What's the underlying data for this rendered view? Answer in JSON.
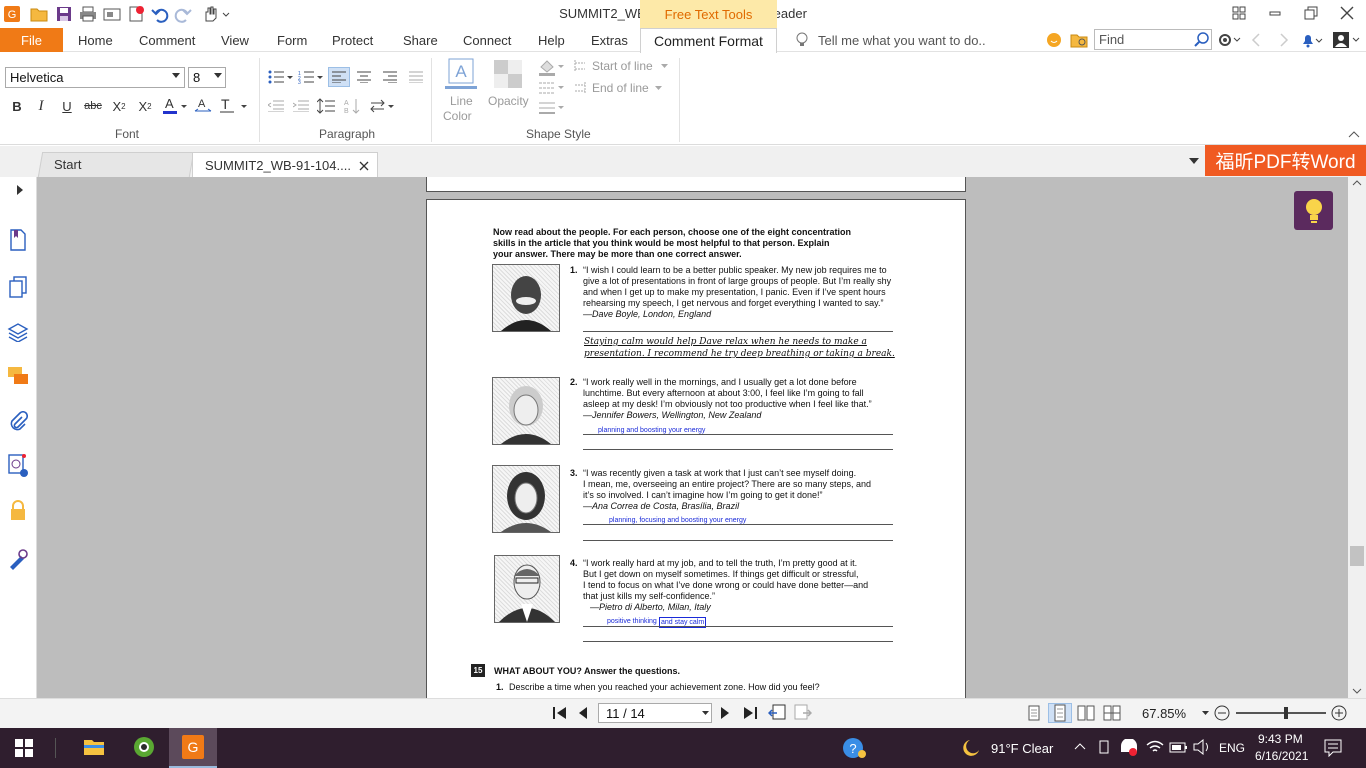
{
  "app": {
    "title": "SUMMIT2_WB-91-104.pdf * - Foxit Reader",
    "context_tab": "Free Text Tools",
    "window_icons": [
      "layout-icon",
      "minimize-icon",
      "restore-icon",
      "close-icon"
    ]
  },
  "menu": {
    "file": "File",
    "items": [
      "Home",
      "Comment",
      "View",
      "Form",
      "Protect",
      "Share",
      "Connect",
      "Help",
      "Extras"
    ],
    "active": "Comment Format",
    "tellme": "Tell me what you want to do..",
    "find_placeholder": "Find"
  },
  "ribbon": {
    "font": {
      "name": "Helvetica",
      "size": "8",
      "group": "Font"
    },
    "paragraph": {
      "group": "Paragraph"
    },
    "shape": {
      "line_color_1": "Line",
      "line_color_2": "Color",
      "opacity": "Opacity",
      "start_of_line": "Start of line",
      "end_of_line": "End of line",
      "group": "Shape Style"
    }
  },
  "tabs": {
    "start": "Start",
    "doc": "SUMMIT2_WB-91-104....",
    "promo": "福昕PDF转Word"
  },
  "page": {
    "intro": [
      "Now read about the people. For each person, choose one of the eight concentration",
      "skills in the article that you think would be most helpful to that person. Explain",
      "your answer. There may be more than one correct answer."
    ],
    "people": [
      {
        "num": "1.",
        "lines": [
          "“I wish I could learn to be a better public speaker. My new job requires me to",
          "give a lot of presentations in front of large groups of people. But I’m really shy",
          "and when I get up to make my presentation, I panic. Even if I’ve spent hours",
          "rehearsing my speech, I get nervous and forget everything I wanted to say.”"
        ],
        "attribution": "—Dave Boyle, London, England",
        "handwritten": [
          "Staying calm would help Dave relax when he needs to make a",
          "presentation. I recommend he try deep breathing or taking a break."
        ]
      },
      {
        "num": "2.",
        "lines": [
          "“I work really well in the mornings, and I usually get a lot done before",
          "lunchtime. But every afternoon at about 3:00, I feel like I’m going to fall",
          "asleep at my desk! I’m obviously not too productive when I feel like that.”"
        ],
        "attribution": "—Jennifer Bowers, Wellington, New Zealand",
        "answer": "planning and boosting your energy"
      },
      {
        "num": "3.",
        "lines": [
          "“I was recently given a task at work that I just can’t see myself doing.",
          "I mean, me, overseeing an entire project? There are so many steps, and",
          "it’s so involved. I can’t imagine how I’m going to get it done!”"
        ],
        "attribution": "—Ana Correa de Costa, Brasília, Brazil",
        "answer": "planning, focusing and boosting your energy"
      },
      {
        "num": "4.",
        "lines": [
          "“I work really hard at my job, and to tell the truth, I’m pretty good at it.",
          "But I get down on myself sometimes. If things get difficult or stressful,",
          "I tend to focus on what I’ve done wrong or could have done better—and",
          "that just kills my self-confidence.”"
        ],
        "attribution": "—Pietro di Alberto, Milan, Italy",
        "answer_a": "positive thinking",
        "answer_b": "and stay calm"
      }
    ],
    "section_num": "15",
    "section_title": "WHAT ABOUT YOU? Answer the questions.",
    "q1_num": "1.",
    "q1": "Describe a time when you reached your achievement zone. How did you feel?"
  },
  "status": {
    "page_indicator": "11 / 14",
    "zoom": "67.85%",
    "zoom_level": 0.55
  },
  "taskbar": {
    "weather": "91°F  Clear",
    "lang": "ENG",
    "time": "9:43 PM",
    "date": "6/16/2021"
  },
  "colors": {
    "accent": "#f07a16",
    "context_tab_bg": "#fde9a8",
    "context_tab_fg": "#e06a00",
    "promo": "#f05a22",
    "bulb_bg": "#5b2a5e",
    "taskbar": "#2f1e2e",
    "annotation": "#1a2ad8"
  }
}
